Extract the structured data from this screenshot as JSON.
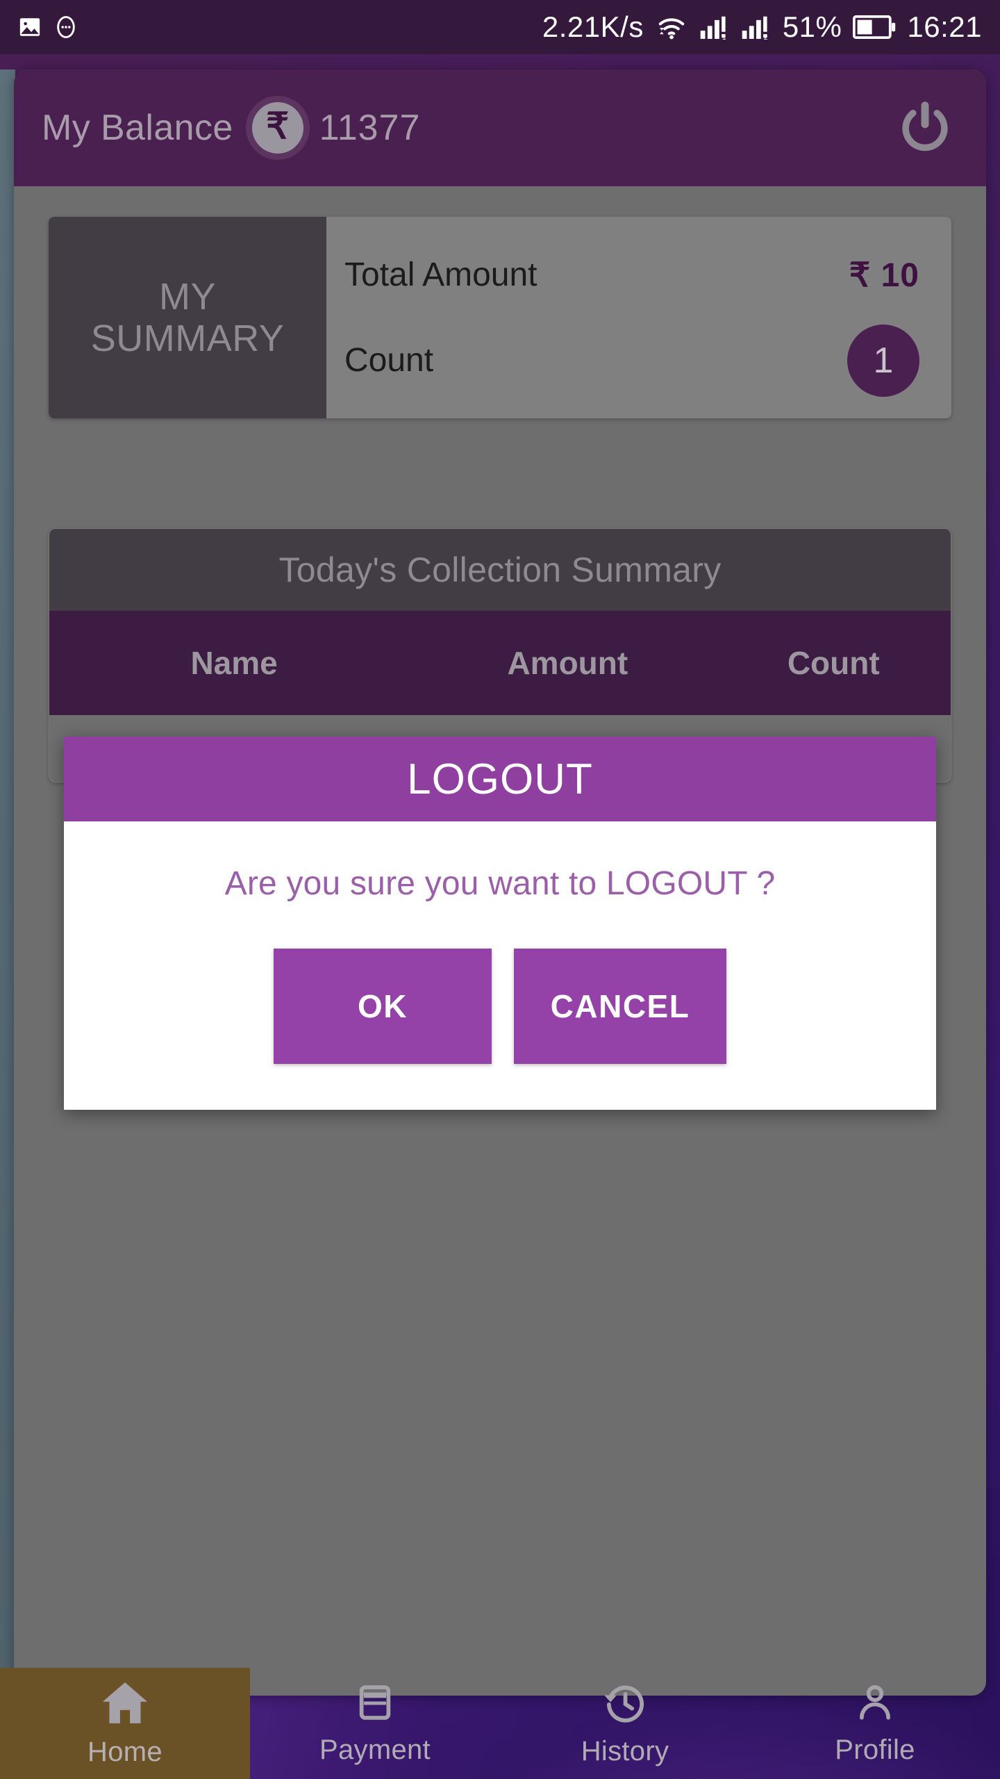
{
  "status_bar": {
    "photo_icon": "image-icon",
    "more_icon": "more-circle-icon",
    "network_speed": "2.21K/s",
    "wifi_icon": "wifi-icon",
    "signal1_icon": "signal-bars-1-icon",
    "signal2_icon": "signal-bars-2-icon",
    "battery_percent": "51%",
    "battery_icon": "battery-icon",
    "clock": "16:21"
  },
  "app_header": {
    "balance_label": "My Balance",
    "rupee_icon": "rupee-circle-icon",
    "rupee_symbol": "₹",
    "balance_value": "11377",
    "power_icon": "power-icon"
  },
  "summary_card": {
    "panel_title_line1": "MY",
    "panel_title_line2": "SUMMARY",
    "rows": [
      {
        "label": "Total Amount",
        "value": "₹ 10"
      },
      {
        "label": "Count",
        "value": "1"
      }
    ]
  },
  "collection_card": {
    "title": "Today's Collection Summary",
    "columns": [
      "Name",
      "Amount",
      "Count"
    ],
    "rows": []
  },
  "dialog": {
    "title": "LOGOUT",
    "message": "Are you sure you want to LOGOUT ?",
    "ok_label": "OK",
    "cancel_label": "CANCEL"
  },
  "bottom_nav": {
    "items": [
      {
        "label": "Home",
        "icon": "home-icon",
        "active": true
      },
      {
        "label": "Payment",
        "icon": "card-icon",
        "active": false
      },
      {
        "label": "History",
        "icon": "history-icon",
        "active": false
      },
      {
        "label": "Profile",
        "icon": "person-icon",
        "active": false
      }
    ]
  },
  "colors": {
    "status_bar_bg": "#35193c",
    "header_bg": "#4a2050",
    "card_bg": "#6e6e6e",
    "dark_panel": "#423c44",
    "table_head": "#3d1c44",
    "dialog_accent": "#8e3fa0",
    "button_purple": "#9542a8",
    "active_tab": "#6b5226",
    "amount_text": "#3d1240"
  }
}
